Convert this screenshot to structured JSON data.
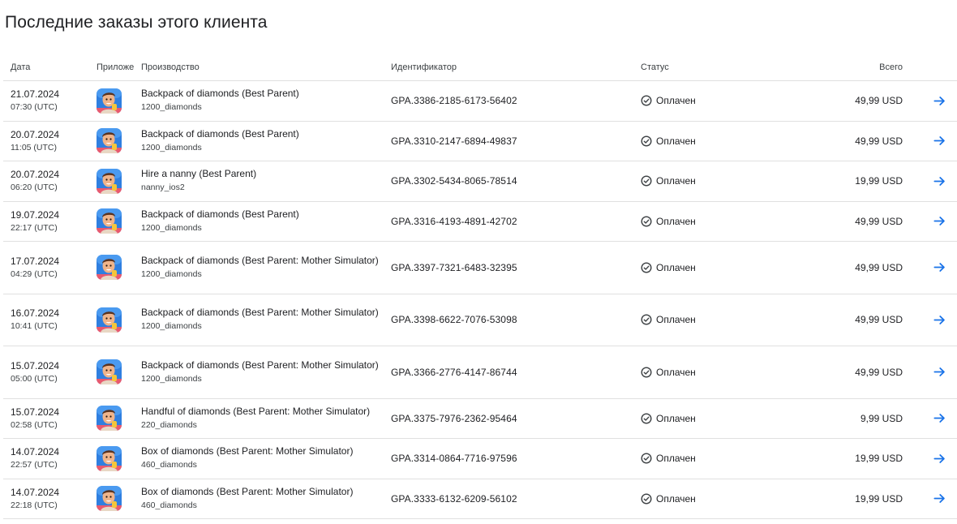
{
  "page": {
    "title": "Последние заказы этого клиента"
  },
  "table": {
    "columns": {
      "date": "Дата",
      "app": "Приложе",
      "product": "Производство",
      "id": "Идентификатор",
      "status": "Статус",
      "total": "Всего"
    },
    "rows": [
      {
        "date": "21.07.2024",
        "time": "07:30 (UTC)",
        "product": "Backpack of diamonds (Best Parent)",
        "sku": "1200_diamonds",
        "id": "GPA.3386-2185-6173-56402",
        "status": "Оплачен",
        "total": "49,99 USD",
        "tall": false
      },
      {
        "date": "20.07.2024",
        "time": "11:05 (UTC)",
        "product": "Backpack of diamonds (Best Parent)",
        "sku": "1200_diamonds",
        "id": "GPA.3310-2147-6894-49837",
        "status": "Оплачен",
        "total": "49,99 USD",
        "tall": false
      },
      {
        "date": "20.07.2024",
        "time": "06:20 (UTC)",
        "product": "Hire a nanny (Best Parent)",
        "sku": "nanny_ios2",
        "id": "GPA.3302-5434-8065-78514",
        "status": "Оплачен",
        "total": "19,99 USD",
        "tall": false
      },
      {
        "date": "19.07.2024",
        "time": "22:17 (UTC)",
        "product": "Backpack of diamonds (Best Parent)",
        "sku": "1200_diamonds",
        "id": "GPA.3316-4193-4891-42702",
        "status": "Оплачен",
        "total": "49,99 USD",
        "tall": false
      },
      {
        "date": "17.07.2024",
        "time": "04:29 (UTC)",
        "product": "Backpack of diamonds (Best Parent: Mother Simulator)",
        "sku": "1200_diamonds",
        "id": "GPA.3397-7321-6483-32395",
        "status": "Оплачен",
        "total": "49,99 USD",
        "tall": true
      },
      {
        "date": "16.07.2024",
        "time": "10:41 (UTC)",
        "product": "Backpack of diamonds (Best Parent: Mother Simulator)",
        "sku": "1200_diamonds",
        "id": "GPA.3398-6622-7076-53098",
        "status": "Оплачен",
        "total": "49,99 USD",
        "tall": true
      },
      {
        "date": "15.07.2024",
        "time": "05:00 (UTC)",
        "product": "Backpack of diamonds (Best Parent: Mother Simulator)",
        "sku": "1200_diamonds",
        "id": "GPA.3366-2776-4147-86744",
        "status": "Оплачен",
        "total": "49,99 USD",
        "tall": true
      },
      {
        "date": "15.07.2024",
        "time": "02:58 (UTC)",
        "product": "Handful of diamonds (Best Parent: Mother Simulator)",
        "sku": "220_diamonds",
        "id": "GPA.3375-7976-2362-95464",
        "status": "Оплачен",
        "total": "9,99 USD",
        "tall": false
      },
      {
        "date": "14.07.2024",
        "time": "22:57 (UTC)",
        "product": "Box of diamonds (Best Parent: Mother Simulator)",
        "sku": "460_diamonds",
        "id": "GPA.3314-0864-7716-97596",
        "status": "Оплачен",
        "total": "19,99 USD",
        "tall": false
      },
      {
        "date": "14.07.2024",
        "time": "22:18 (UTC)",
        "product": "Box of diamonds (Best Parent: Mother Simulator)",
        "sku": "460_diamonds",
        "id": "GPA.3333-6132-6209-56102",
        "status": "Оплачен",
        "total": "19,99 USD",
        "tall": false
      }
    ]
  },
  "icons": {
    "app": "app-icon-best-parent",
    "status": "check-circle-icon",
    "details": "arrow-right-icon"
  },
  "colors": {
    "accent": "#1a73e8",
    "text": "#202124",
    "divider": "#e0e0e0",
    "app_bg": "#2f7fe0"
  }
}
